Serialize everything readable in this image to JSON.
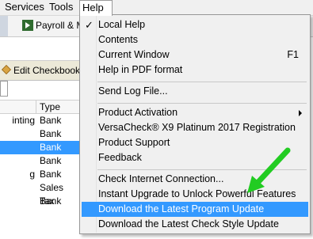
{
  "menubar": {
    "services": "Services",
    "tools": "Tools",
    "help": "Help"
  },
  "toolbar": {
    "payroll_label": "Payroll & M"
  },
  "edit_checkbook": "Edit Checkbook",
  "grid": {
    "type_header": "Type",
    "rows": [
      {
        "name": "inting",
        "type": "Bank"
      },
      {
        "name": "",
        "type": "Bank"
      },
      {
        "name": "",
        "type": "Bank",
        "selected": true
      },
      {
        "name": "",
        "type": "Bank"
      },
      {
        "name": "g",
        "type": "Bank"
      },
      {
        "name": "",
        "type": "Sales Tax"
      },
      {
        "name": "",
        "type": "Bank"
      }
    ]
  },
  "help_menu": {
    "local_help": "Local Help",
    "contents": "Contents",
    "current_window": "Current Window",
    "current_window_shortcut": "F1",
    "help_pdf": "Help in PDF format",
    "send_log": "Send Log File...",
    "product_activation": "Product Activation",
    "registration": "VersaCheck® X9 Platinum 2017 Registration",
    "product_support": "Product Support",
    "feedback": "Feedback",
    "check_internet": "Check Internet Connection...",
    "instant_upgrade": "Instant Upgrade to Unlock Powerful Features",
    "download_program": "Download the Latest Program Update",
    "download_check_style": "Download the Latest Check Style Update"
  },
  "colors": {
    "highlight": "#3399ff",
    "arrow": "#22cc22"
  }
}
